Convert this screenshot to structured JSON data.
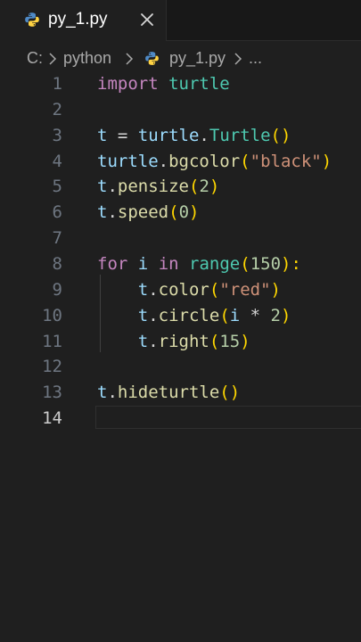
{
  "tab": {
    "filename": "py_1.py",
    "icon": "python-icon",
    "close_icon": "close-icon"
  },
  "breadcrumb": {
    "drive": "C:",
    "folder": "python",
    "file": "py_1.py",
    "more": "..."
  },
  "editor": {
    "active_line": 14,
    "lines": [
      {
        "number": "1",
        "tokens": [
          {
            "t": "import",
            "c": "kw"
          },
          {
            "t": " ",
            "c": "op"
          },
          {
            "t": "turtle",
            "c": "mod"
          }
        ]
      },
      {
        "number": "2",
        "tokens": []
      },
      {
        "number": "3",
        "tokens": [
          {
            "t": "t",
            "c": "var"
          },
          {
            "t": " = ",
            "c": "op"
          },
          {
            "t": "turtle",
            "c": "var"
          },
          {
            "t": ".",
            "c": "op"
          },
          {
            "t": "Turtle",
            "c": "mod"
          },
          {
            "t": "()",
            "c": "paren"
          }
        ]
      },
      {
        "number": "4",
        "tokens": [
          {
            "t": "turtle",
            "c": "var"
          },
          {
            "t": ".",
            "c": "op"
          },
          {
            "t": "bgcolor",
            "c": "fn"
          },
          {
            "t": "(",
            "c": "paren"
          },
          {
            "t": "\"black\"",
            "c": "str"
          },
          {
            "t": ")",
            "c": "paren"
          }
        ]
      },
      {
        "number": "5",
        "tokens": [
          {
            "t": "t",
            "c": "var"
          },
          {
            "t": ".",
            "c": "op"
          },
          {
            "t": "pensize",
            "c": "fn"
          },
          {
            "t": "(",
            "c": "paren"
          },
          {
            "t": "2",
            "c": "num"
          },
          {
            "t": ")",
            "c": "paren"
          }
        ]
      },
      {
        "number": "6",
        "tokens": [
          {
            "t": "t",
            "c": "var"
          },
          {
            "t": ".",
            "c": "op"
          },
          {
            "t": "speed",
            "c": "fn"
          },
          {
            "t": "(",
            "c": "paren"
          },
          {
            "t": "0",
            "c": "num"
          },
          {
            "t": ")",
            "c": "paren"
          }
        ]
      },
      {
        "number": "7",
        "tokens": []
      },
      {
        "number": "8",
        "tokens": [
          {
            "t": "for",
            "c": "kw"
          },
          {
            "t": " ",
            "c": "op"
          },
          {
            "t": "i",
            "c": "var"
          },
          {
            "t": " ",
            "c": "op"
          },
          {
            "t": "in",
            "c": "kw"
          },
          {
            "t": " ",
            "c": "op"
          },
          {
            "t": "range",
            "c": "bi"
          },
          {
            "t": "(",
            "c": "paren"
          },
          {
            "t": "150",
            "c": "num"
          },
          {
            "t": "):",
            "c": "paren"
          }
        ]
      },
      {
        "number": "9",
        "tokens": [
          {
            "t": "    ",
            "c": "op"
          },
          {
            "t": "t",
            "c": "var"
          },
          {
            "t": ".",
            "c": "op"
          },
          {
            "t": "color",
            "c": "fn"
          },
          {
            "t": "(",
            "c": "paren"
          },
          {
            "t": "\"red\"",
            "c": "str"
          },
          {
            "t": ")",
            "c": "paren"
          }
        ]
      },
      {
        "number": "10",
        "tokens": [
          {
            "t": "    ",
            "c": "op"
          },
          {
            "t": "t",
            "c": "var"
          },
          {
            "t": ".",
            "c": "op"
          },
          {
            "t": "circle",
            "c": "fn"
          },
          {
            "t": "(",
            "c": "paren"
          },
          {
            "t": "i",
            "c": "var"
          },
          {
            "t": " * ",
            "c": "op"
          },
          {
            "t": "2",
            "c": "num"
          },
          {
            "t": ")",
            "c": "paren"
          }
        ]
      },
      {
        "number": "11",
        "tokens": [
          {
            "t": "    ",
            "c": "op"
          },
          {
            "t": "t",
            "c": "var"
          },
          {
            "t": ".",
            "c": "op"
          },
          {
            "t": "right",
            "c": "fn"
          },
          {
            "t": "(",
            "c": "paren"
          },
          {
            "t": "15",
            "c": "num"
          },
          {
            "t": ")",
            "c": "paren"
          }
        ]
      },
      {
        "number": "12",
        "tokens": []
      },
      {
        "number": "13",
        "tokens": [
          {
            "t": "t",
            "c": "var"
          },
          {
            "t": ".",
            "c": "op"
          },
          {
            "t": "hideturtle",
            "c": "fn"
          },
          {
            "t": "()",
            "c": "paren"
          }
        ]
      },
      {
        "number": "14",
        "tokens": []
      }
    ]
  }
}
